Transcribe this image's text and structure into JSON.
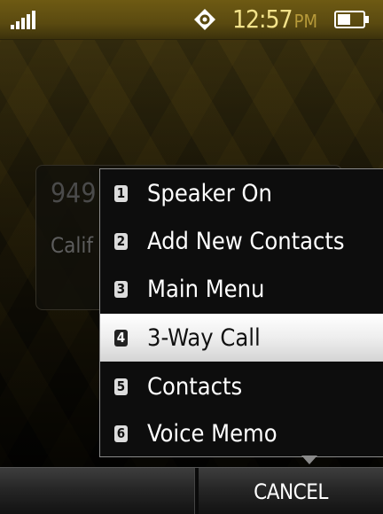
{
  "status_bar": {
    "signal_icon": "signal-strength-icon",
    "gps_icon": "gps-location-icon",
    "time": "12:57",
    "ampm": "PM",
    "battery_icon": "battery-icon",
    "battery_level": 0.5
  },
  "call_card": {
    "number": "949",
    "location": "Calif"
  },
  "menu": {
    "items": [
      {
        "number": "1",
        "label": "Speaker On"
      },
      {
        "number": "2",
        "label": "Add New Contacts"
      },
      {
        "number": "3",
        "label": "Main Menu"
      },
      {
        "number": "4",
        "label": "3-Way Call"
      },
      {
        "number": "5",
        "label": "Contacts"
      },
      {
        "number": "6",
        "label": "Voice Memo"
      }
    ],
    "selected_number": "4"
  },
  "softkeys": {
    "left": "",
    "right": "CANCEL"
  },
  "colors": {
    "status_bar": "#5a4a10",
    "clock_text": "#f3e28a",
    "highlight": "#ffffff",
    "menu_background": "#0d0d0d"
  }
}
